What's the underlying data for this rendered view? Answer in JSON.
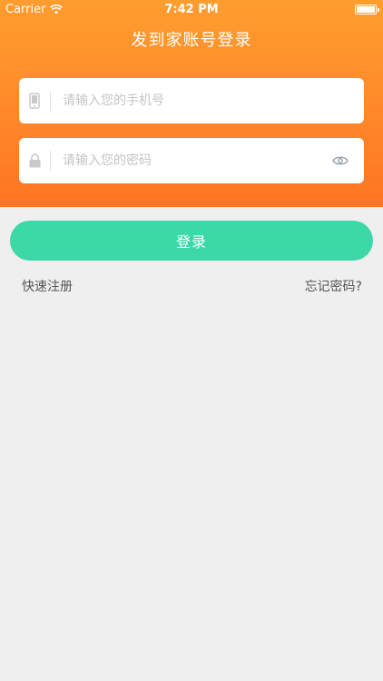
{
  "status_bar": {
    "carrier": "Carrier",
    "time": "7:42 PM"
  },
  "header": {
    "title": "发到家账号登录"
  },
  "form": {
    "phone": {
      "value": "",
      "placeholder": "请输入您的手机号",
      "icon": "phone-icon"
    },
    "password": {
      "value": "",
      "placeholder": "请输入您的密码",
      "icon": "lock-icon",
      "toggle_icon": "eye-icon"
    }
  },
  "actions": {
    "login_label": "登录",
    "register_label": "快速注册",
    "forgot_label": "忘记密码?"
  },
  "colors": {
    "header_top": "#ff9d2e",
    "header_bottom": "#ff7424",
    "login_button": "#3dd8a8",
    "background": "#efefef"
  }
}
